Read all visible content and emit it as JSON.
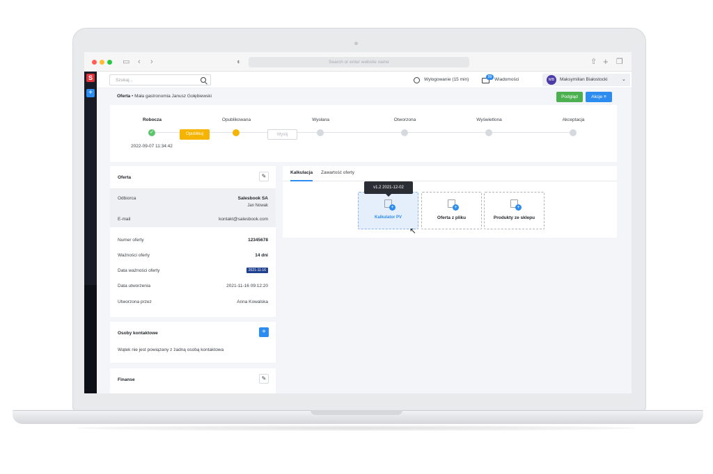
{
  "browser": {
    "url_placeholder": "Search or enter website name",
    "traffic_lights": [
      "#ff5f57",
      "#febc2e",
      "#28c840"
    ]
  },
  "app": {
    "logo_letter": "S",
    "add_symbol": "+"
  },
  "topbar": {
    "search_placeholder": "Szukaj...",
    "logout_label": "Wylogowanie (15 min)",
    "messages_label": "Wiadomości",
    "messages_badge": "99",
    "user_initials": "MB",
    "user_name": "Maksymilian Białostocki"
  },
  "page": {
    "breadcrumb_section": "Oferta",
    "breadcrumb_sep": "•",
    "breadcrumb_item": "Mała gastronomia Janusz Gołębiewski",
    "preview_button": "Podgląd",
    "actions_button": "Akcje ≡"
  },
  "stepper": {
    "steps": [
      {
        "label": "Robocza",
        "state": "done"
      },
      {
        "label": "Opublikowana",
        "state": "current"
      },
      {
        "label": "Wysłana",
        "state": "todo"
      },
      {
        "label": "Otworzona",
        "state": "todo"
      },
      {
        "label": "Wyświetlona",
        "state": "todo"
      },
      {
        "label": "Akceptacja",
        "state": "todo"
      }
    ],
    "date": "2022-09-07 11:34:42",
    "publish_button": "Opublikuj",
    "send_button": "Wyślij",
    "colors": {
      "done": "#5cc46b",
      "current": "#f5b400",
      "todo": "#d6d9dd"
    }
  },
  "offer_panel": {
    "title": "Oferta",
    "recipient_label": "Odbiorca",
    "recipient_company": "Salesbook SA",
    "recipient_person": "Jan Nowak",
    "email_label": "E-mail",
    "email_value": "kontakt@salesbook.com",
    "number_label": "Numer oferty",
    "number_value": "12345678",
    "validity_label": "Ważności oferty",
    "validity_value": "14 dni",
    "valid_date_label": "Data ważności oferty",
    "valid_date_value": "2021-11-16",
    "created_label": "Data utworzenia",
    "created_value": "2021-11-16 09:12:20",
    "created_by_label": "Utworzona przez",
    "created_by_value": "Anna Kowalska"
  },
  "contacts_panel": {
    "title": "Osoby kontaktowe",
    "add_symbol": "+",
    "empty_text": "Wątek nie jest powiązany z żadną osobą kontaktowa"
  },
  "finance_panel": {
    "title": "Finanse"
  },
  "right_panel": {
    "tabs": [
      "Kalkulacja",
      "Zawartość oferty"
    ],
    "tooltip": "v1.2  2021-12-02",
    "tiles": [
      "Kalkulator PV",
      "Oferta z pliku",
      "Produkty ze sklepu"
    ]
  }
}
